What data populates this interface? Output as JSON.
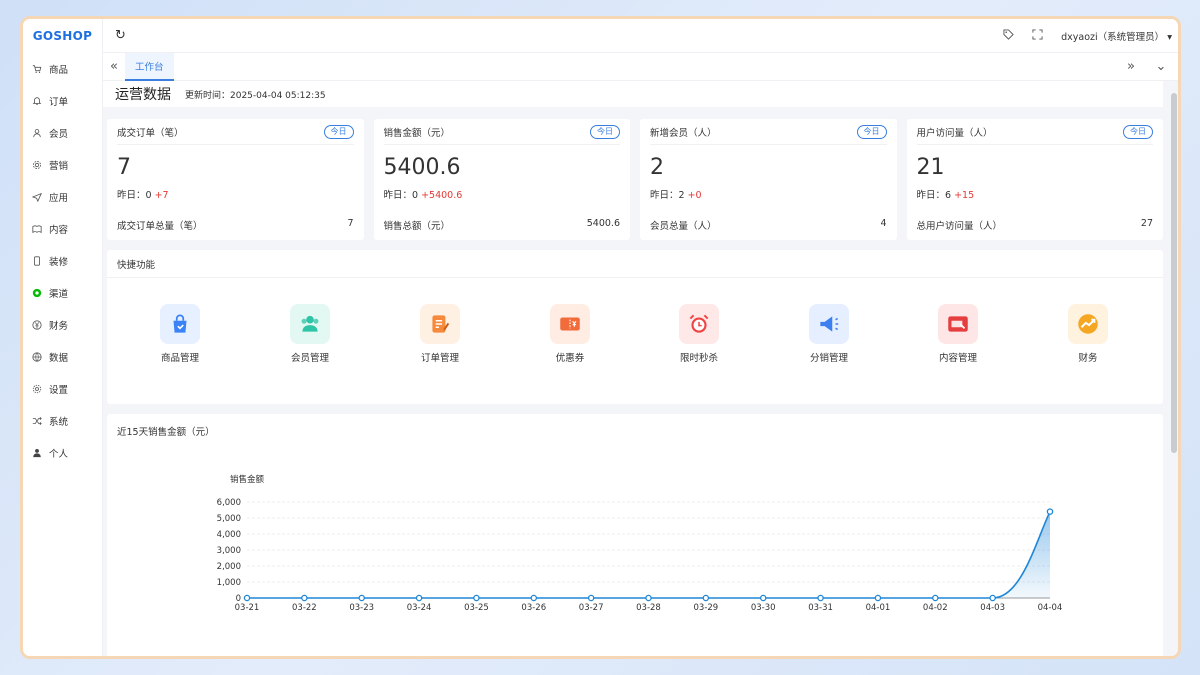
{
  "app": {
    "logo": "GOSHOP"
  },
  "sidebar": {
    "items": [
      {
        "label": "商品",
        "icon": "cart-icon"
      },
      {
        "label": "订单",
        "icon": "bell-icon"
      },
      {
        "label": "会员",
        "icon": "user-icon"
      },
      {
        "label": "营销",
        "icon": "gear-icon"
      },
      {
        "label": "应用",
        "icon": "send-icon"
      },
      {
        "label": "内容",
        "icon": "book-icon"
      },
      {
        "label": "装修",
        "icon": "phone-icon"
      },
      {
        "label": "渠道",
        "icon": "wechat-icon"
      },
      {
        "label": "财务",
        "icon": "yen-icon"
      },
      {
        "label": "数据",
        "icon": "globe-icon"
      },
      {
        "label": "设置",
        "icon": "settings-icon"
      },
      {
        "label": "系统",
        "icon": "shuffle-icon"
      },
      {
        "label": "个人",
        "icon": "person-icon"
      }
    ]
  },
  "topbar": {
    "user": "dxyaozi（系统管理员）"
  },
  "tabs": {
    "active": "工作台"
  },
  "ops": {
    "title": "运营数据",
    "updated": "更新时间：2025-04-04 05:12:35"
  },
  "cards": [
    {
      "title": "成交订单（笔）",
      "badge": "今日",
      "value": "7",
      "yest_label": "昨日：0",
      "delta": "+7",
      "foot_label": "成交订单总量（笔）",
      "foot_value": "7"
    },
    {
      "title": "销售金额（元）",
      "badge": "今日",
      "value": "5400.6",
      "yest_label": "昨日：0",
      "delta": "+5400.6",
      "foot_label": "销售总额（元）",
      "foot_value": "5400.6"
    },
    {
      "title": "新增会员（人）",
      "badge": "今日",
      "value": "2",
      "yest_label": "昨日：2",
      "delta": "+0",
      "foot_label": "会员总量（人）",
      "foot_value": "4"
    },
    {
      "title": "用户访问量（人）",
      "badge": "今日",
      "value": "21",
      "yest_label": "昨日：6",
      "delta": "+15",
      "foot_label": "总用户访问量（人）",
      "foot_value": "27"
    }
  ],
  "quick": {
    "title": "快捷功能",
    "items": [
      {
        "label": "商品管理",
        "icon": "shopping-bag-icon",
        "color": "#3b82f6",
        "bg": "#e6f0ff"
      },
      {
        "label": "会员管理",
        "icon": "members-icon",
        "color": "#2ec4a6",
        "bg": "#e3f8f3"
      },
      {
        "label": "订单管理",
        "icon": "order-icon",
        "color": "#f58a3c",
        "bg": "#fff0e4"
      },
      {
        "label": "优惠券",
        "icon": "coupon-icon",
        "color": "#f26b3a",
        "bg": "#ffece3"
      },
      {
        "label": "限时秒杀",
        "icon": "alarm-clock-icon",
        "color": "#ef4444",
        "bg": "#ffe8e8"
      },
      {
        "label": "分销管理",
        "icon": "megaphone-icon",
        "color": "#3b7ff0",
        "bg": "#e6efff"
      },
      {
        "label": "内容管理",
        "icon": "content-icon",
        "color": "#e53e3e",
        "bg": "#ffe6e6"
      },
      {
        "label": "财务",
        "icon": "finance-icon",
        "color": "#f5a623",
        "bg": "#fff3df"
      }
    ]
  },
  "chart_data": {
    "type": "area",
    "title": "近15天销售金额（元）",
    "ylabel": "销售金额",
    "x": [
      "03-21",
      "03-22",
      "03-23",
      "03-24",
      "03-25",
      "03-26",
      "03-27",
      "03-28",
      "03-29",
      "03-30",
      "03-31",
      "04-01",
      "04-02",
      "04-03",
      "04-04"
    ],
    "values": [
      0,
      0,
      0,
      0,
      0,
      0,
      0,
      0,
      0,
      0,
      0,
      0,
      0,
      0,
      5400.6
    ],
    "yticks": [
      "0",
      "1,000",
      "2,000",
      "3,000",
      "4,000",
      "5,000",
      "6,000"
    ],
    "ylim": [
      0,
      6000
    ],
    "color": "#1f86d8",
    "grid": true
  }
}
